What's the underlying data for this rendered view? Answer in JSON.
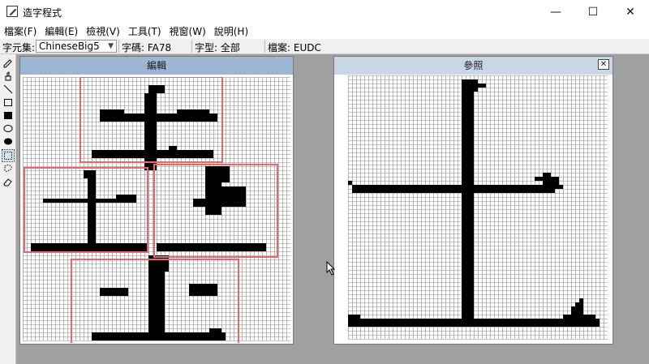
{
  "window": {
    "title": "造字程式",
    "minimize": "—",
    "maximize": "☐",
    "close": "✕"
  },
  "menu": [
    "檔案(F)",
    "編輯(E)",
    "檢視(V)",
    "工具(T)",
    "視窗(W)",
    "說明(H)"
  ],
  "info": {
    "charset_label": "字元集:",
    "charset_value": "ChineseBig5",
    "code": "字碼: FA78",
    "font": "字型: 全部",
    "file": "檔案: EUDC"
  },
  "tools": [
    "pencil-icon",
    "brush-icon",
    "line-icon",
    "rect-outline-icon",
    "rect-filled-icon",
    "ellipse-outline-icon",
    "ellipse-filled-icon",
    "rect-select-icon",
    "freeform-select-icon",
    "eraser-icon"
  ],
  "edit_panel": {
    "title": "編輯",
    "title_bg": "#9db6d4",
    "selection_color": "#e8676b"
  },
  "ref_panel": {
    "title": "參照",
    "title_bg": "#c9d6e6",
    "close_label": "✕"
  }
}
